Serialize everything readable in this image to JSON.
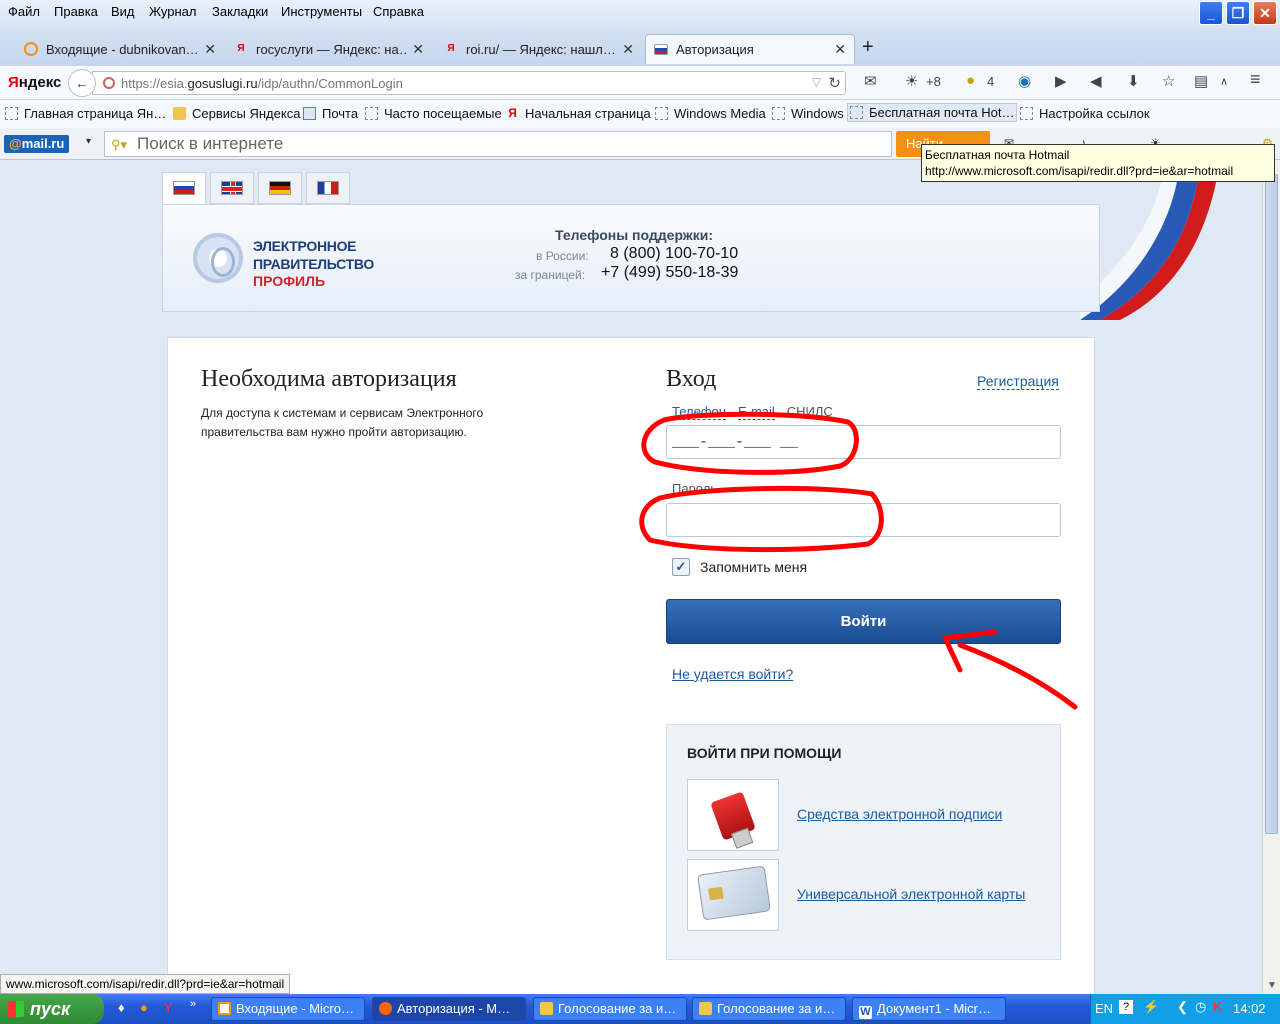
{
  "menu": [
    "Файл",
    "Правка",
    "Вид",
    "Журнал",
    "Закладки",
    "Инструменты",
    "Справка"
  ],
  "window_buttons": {
    "minimize": "_",
    "maximize": "❐",
    "close": "✕"
  },
  "tabs": [
    {
      "label": "Входящие - dubnikovan…",
      "close": "✕"
    },
    {
      "label": "госуслуги — Яндекс: на…",
      "close": "✕"
    },
    {
      "label": "roi.ru/ — Яндекс: нашл…",
      "close": "✕"
    },
    {
      "label": "Авторизация",
      "close": "✕"
    }
  ],
  "new_tab": "+",
  "nav": {
    "yandex_logo_first": "Я",
    "yandex_logo_rest": "ндекс",
    "back": "←",
    "url_prefix": "https://esia.",
    "url_domain": "gosuslugi.ru",
    "url_path": "/idp/authn/CommonLogin",
    "weather": "+8",
    "badge_count": "4"
  },
  "bookmarks": [
    "Главная страница Ян…",
    "Сервисы Яндекса",
    "Почта",
    "Часто посещаемые",
    "Начальная страница",
    "Windows Media",
    "Windows",
    "Бесплатная почта Hot…",
    "Настройка ссылок"
  ],
  "mailru": {
    "logo_at": "@",
    "logo_text": "mail.ru",
    "search_placeholder": "Поиск в интернете",
    "find_button": "Найти"
  },
  "tooltip": {
    "title": "Бесплатная почта Hotmail",
    "url": "http://www.microsoft.com/isapi/redir.dll?prd=ie&ar=hotmail"
  },
  "header": {
    "logo_line1": "ЭЛЕКТРОННОЕ",
    "logo_line2": "ПРАВИТЕЛЬСТВО",
    "logo_line3": "ПРОФИЛЬ",
    "support_title": "Телефоны поддержки:",
    "russia_label": "в России:",
    "russia_phone": "8 (800) 100-70-10",
    "abroad_label": "за границей:",
    "abroad_phone": "+7 (499) 550-18-39"
  },
  "auth": {
    "title": "Необходима авторизация",
    "description": "Для доступа к системам и сервисам Электронного правительства вам нужно пройти авторизацию."
  },
  "login": {
    "title": "Вход",
    "register_link": "Регистрация",
    "id_tabs": [
      "Телефон",
      "E-mail",
      "СНИЛС"
    ],
    "login_value": "___-___-___ __",
    "password_label": "Пароль",
    "password_value": "",
    "remember_label": "Запомнить меня",
    "remember_checked": true,
    "submit_label": "Войти",
    "cant_login_link": "Не удается войти?"
  },
  "alt_login": {
    "title": "ВОЙТИ ПРИ ПОМОЩИ",
    "options": [
      "Средства электронной подписи",
      "Универсальной электронной карты"
    ]
  },
  "status_link": "www.microsoft.com/isapi/redir.dll?prd=ie&ar=hotmail",
  "taskbar": {
    "start": "пуск",
    "tasks": [
      "Входящие - Micro…",
      "Авторизация - M…",
      "Голосование за и…",
      "Голосование за и…",
      "Документ1 - Micr…"
    ],
    "lang": "EN",
    "time": "14:02"
  },
  "colors": {
    "accent_blue": "#1c5aa0",
    "button_blue": "#2a5fa8",
    "annotation_red": "#ff0000",
    "brand_red": "#d2232a"
  }
}
